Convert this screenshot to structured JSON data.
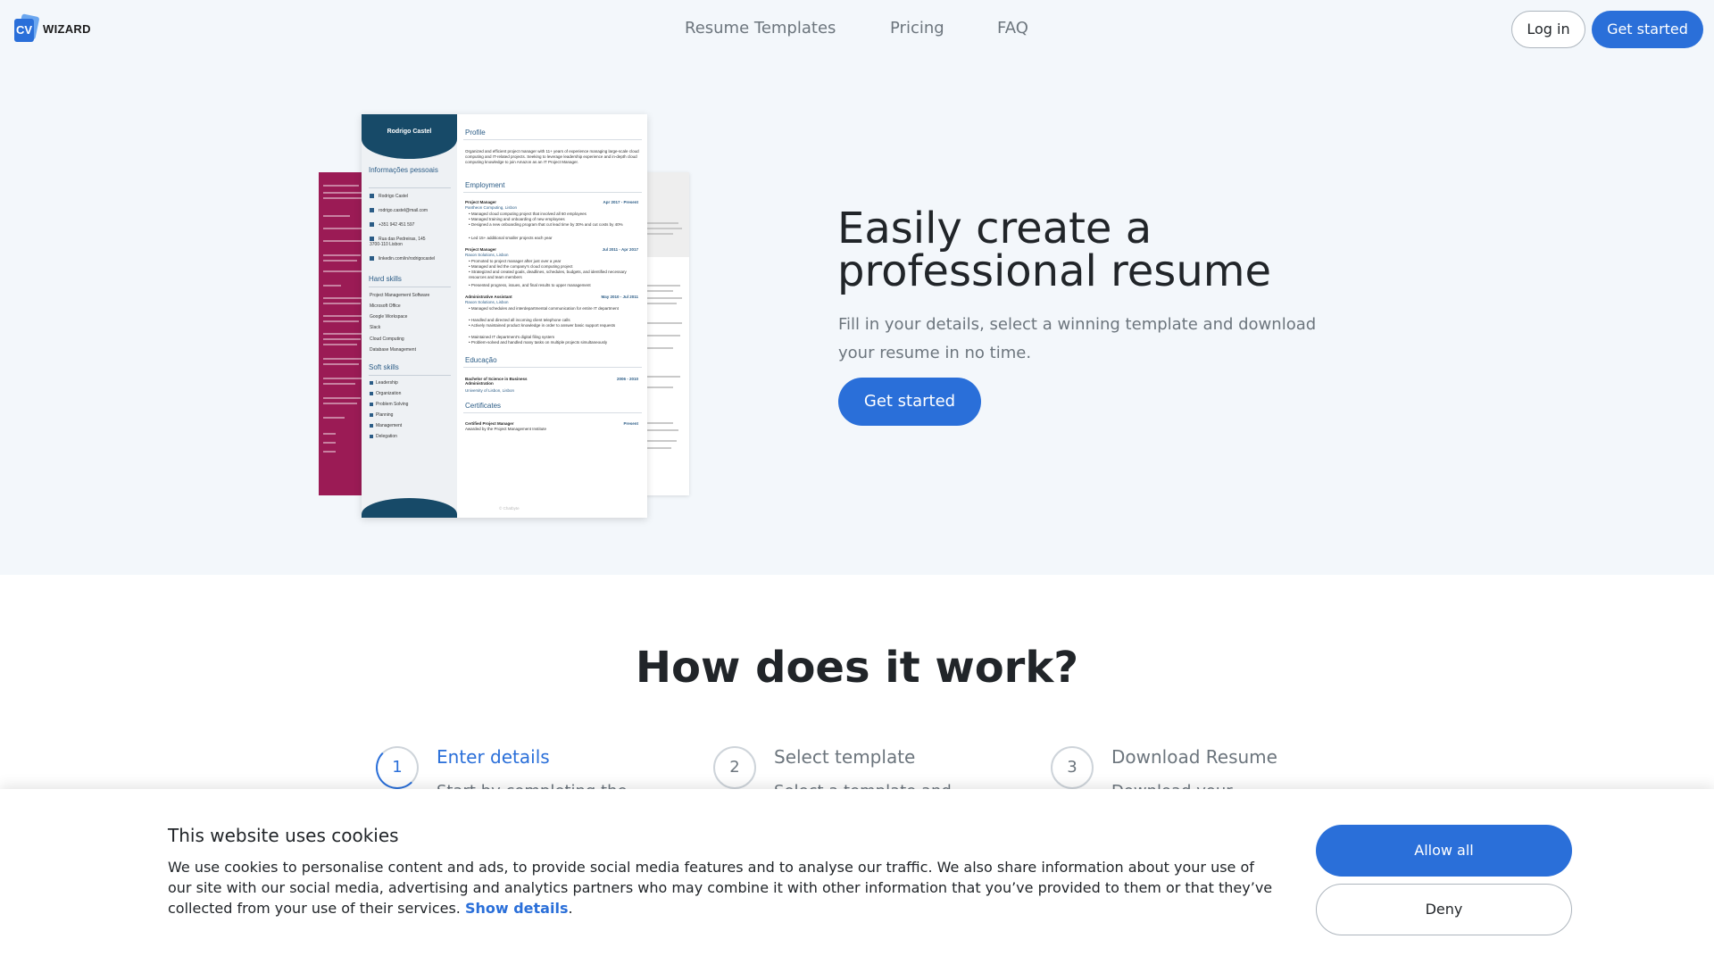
{
  "brand": {
    "logo_mark": "CV",
    "logo_text": "WIZARD",
    "accent": "#2a6fd9",
    "resume_accent": "#174a68",
    "alt_template_color": "#9b1b55"
  },
  "nav": {
    "items": [
      "Resume Templates",
      "Pricing",
      "FAQ"
    ]
  },
  "header": {
    "login_label": "Log in",
    "get_started_label": "Get started"
  },
  "hero": {
    "title": "Easily create a professional resume",
    "subtitle": "Fill in your details, select a winning template and download your resume in no time.",
    "cta_label": "Get started"
  },
  "resume": {
    "name": "Rodrigo Castel",
    "info_heading": "Informações pessoais",
    "contact": [
      "Rodrigo Castel",
      "rodrigo.castel@mail.com",
      "+351 942 451 597",
      "Rua das Pedreiras, 145 3700-110 Lisbon",
      "linkedin.com/in/rodrigocastel"
    ],
    "hard_skills_heading": "Hard skills",
    "hard_skills": [
      "Project Management Software",
      "Microsoft Office",
      "Google Workspace",
      "Slack",
      "Cloud Computing",
      "Database Management"
    ],
    "soft_skills_heading": "Soft skills",
    "soft_skills": [
      "Leadership",
      "Organization",
      "Problem Solving",
      "Planning",
      "Management",
      "Delegation"
    ],
    "profile_heading": "Profile",
    "profile": "Organized and efficient project manager with 11+ years of experience managing large-scale cloud computing and IT-related projects. Seeking to leverage leadership experience and in-depth cloud computing knowledge to join Amazon as an IT Project Manager.",
    "employment_heading": "Employment",
    "jobs": [
      {
        "title": "Project Manager",
        "company": "Pantheon Computing, Lisbon",
        "dates": "Apr 2017 - Present",
        "bullets": [
          "Managed cloud computing project that involved all 60 employees",
          "Managed training and onboarding of new employees",
          "Designed a new onboarding program that cut lead time by 30% and cut costs by 40%",
          "Led 15+ additional smaller projects each year"
        ]
      },
      {
        "title": "Project Manager",
        "company": "Raxon Solutions, Lisbon",
        "dates": "Jul 2011 - Apr 2017",
        "bullets": [
          "Promoted to project manager after just over a year",
          "Managed and led the company's cloud computing project",
          "Strategized and created goals, deadlines, schedules, budgets, and identified necessary resources and team members",
          "Presented progress, issues, and final results to upper management"
        ]
      },
      {
        "title": "Administrative Assistant",
        "company": "Raxon Solutions, Lisbon",
        "dates": "May 2010 - Jul 2011",
        "bullets": [
          "Managed schedules and interdepartmental communication for entire IT department",
          "Handled and directed all incoming client telephone calls",
          "Actively maintained product knowledge in order to answer basic support requests",
          "Maintained IT department's digital filing system",
          "Problem-solved and handled many tasks on multiple projects simultaneously"
        ]
      }
    ],
    "education_heading": "Educação",
    "degree": "Bachelor of Science in Business Administration",
    "school": "University of Lisbon, Lisbon",
    "edu_dates": "2006 - 2010",
    "certificates_heading": "Certificates",
    "certificate": "Certified Project Manager",
    "certificate_dates": "Present",
    "certificate_detail": "Awarded by the Project Management Institute",
    "footer": "© Chatbyte"
  },
  "how": {
    "title": "How does it work?",
    "steps": [
      {
        "number": "1",
        "label": "Enter details",
        "desc": "Start by completing the"
      },
      {
        "number": "2",
        "label": "Select template",
        "desc": "Select a template and"
      },
      {
        "number": "3",
        "label": "Download Resume",
        "desc": "Download your"
      }
    ]
  },
  "cookie": {
    "title": "This website uses cookies",
    "text": "We use cookies to personalise content and ads, to provide social media features and to analyse our traffic. We also share information about your use of our site with our social media, advertising and analytics partners who may combine it with other information that you’ve provided to them or that they’ve collected from your use of their services.",
    "link": "Show details",
    "allow_label": "Allow all",
    "deny_label": "Deny"
  }
}
